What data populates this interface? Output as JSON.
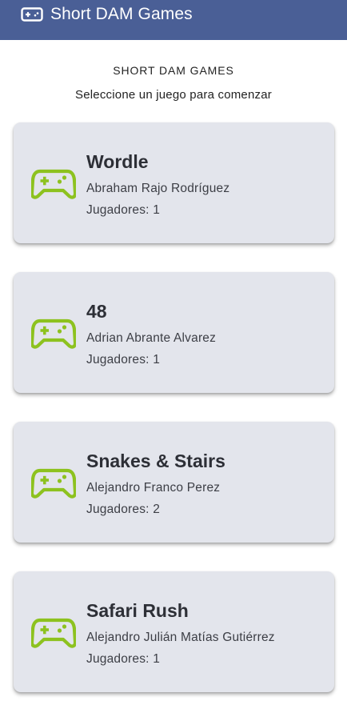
{
  "app_bar": {
    "icon": "gamepad-icon",
    "title": "Short DAM Games",
    "background_color": "#4a5f96"
  },
  "header": {
    "title": "SHORT DAM GAMES",
    "subtitle": "Seleccione un juego para comenzar"
  },
  "games": [
    {
      "title": "Wordle",
      "author": "Abraham Rajo Rodríguez",
      "players_label": "Jugadores:",
      "players": "1",
      "icon": "gamepad-icon"
    },
    {
      "title": "48",
      "author": "Adrian Abrante Alvarez",
      "players_label": "Jugadores:",
      "players": "1",
      "icon": "gamepad-icon"
    },
    {
      "title": "Snakes & Stairs",
      "author": "Alejandro Franco Perez",
      "players_label": "Jugadores:",
      "players": "2",
      "icon": "gamepad-icon"
    },
    {
      "title": "Safari Rush",
      "author": "Alejandro Julián Matías Gutiérrez",
      "players_label": "Jugadores:",
      "players": "1",
      "icon": "gamepad-icon"
    }
  ],
  "colors": {
    "accent_icon": "#8dc21f",
    "card_background": "#e3e5ec"
  }
}
